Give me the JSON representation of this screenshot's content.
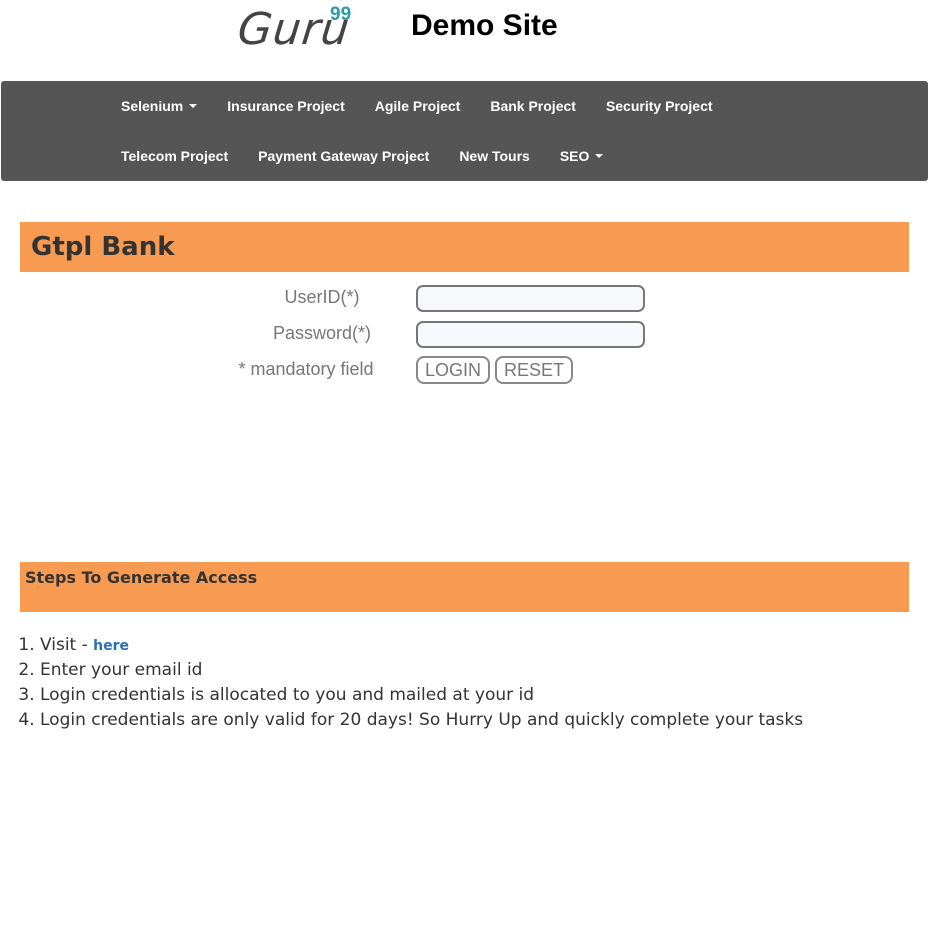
{
  "header": {
    "logo_text": "Guru",
    "logo_sup": "99",
    "site_title": "Demo Site"
  },
  "nav": {
    "row1": [
      {
        "label": "Selenium",
        "dropdown": true
      },
      {
        "label": "Insurance Project",
        "dropdown": false
      },
      {
        "label": "Agile Project",
        "dropdown": false
      },
      {
        "label": "Bank Project",
        "dropdown": false
      },
      {
        "label": "Security Project",
        "dropdown": false
      }
    ],
    "row2": [
      {
        "label": "Telecom Project",
        "dropdown": false
      },
      {
        "label": "Payment Gateway Project",
        "dropdown": false
      },
      {
        "label": "New Tours",
        "dropdown": false
      },
      {
        "label": "SEO",
        "dropdown": true
      }
    ]
  },
  "bank": {
    "title": "Gtpl Bank"
  },
  "login_form": {
    "userid_label": "UserID(*)",
    "userid_value": "",
    "password_label": "Password(*)",
    "password_value": "",
    "mandatory_note": "* mandatory field",
    "login_button": "LOGIN",
    "reset_button": "RESET"
  },
  "steps": {
    "title": "Steps To Generate Access",
    "items": [
      {
        "text": "Visit - ",
        "link": "here"
      },
      {
        "text": "Enter your email id"
      },
      {
        "text": "Login credentials is allocated to you and mailed at your id"
      },
      {
        "text": "Login credentials are only valid for 20 days! So Hurry Up and quickly complete your tasks"
      }
    ]
  },
  "colors": {
    "navbar_bg": "#555555",
    "header_accent": "#f79b52",
    "logo_accent": "#2a9ca6",
    "link": "#2a6fb5"
  }
}
